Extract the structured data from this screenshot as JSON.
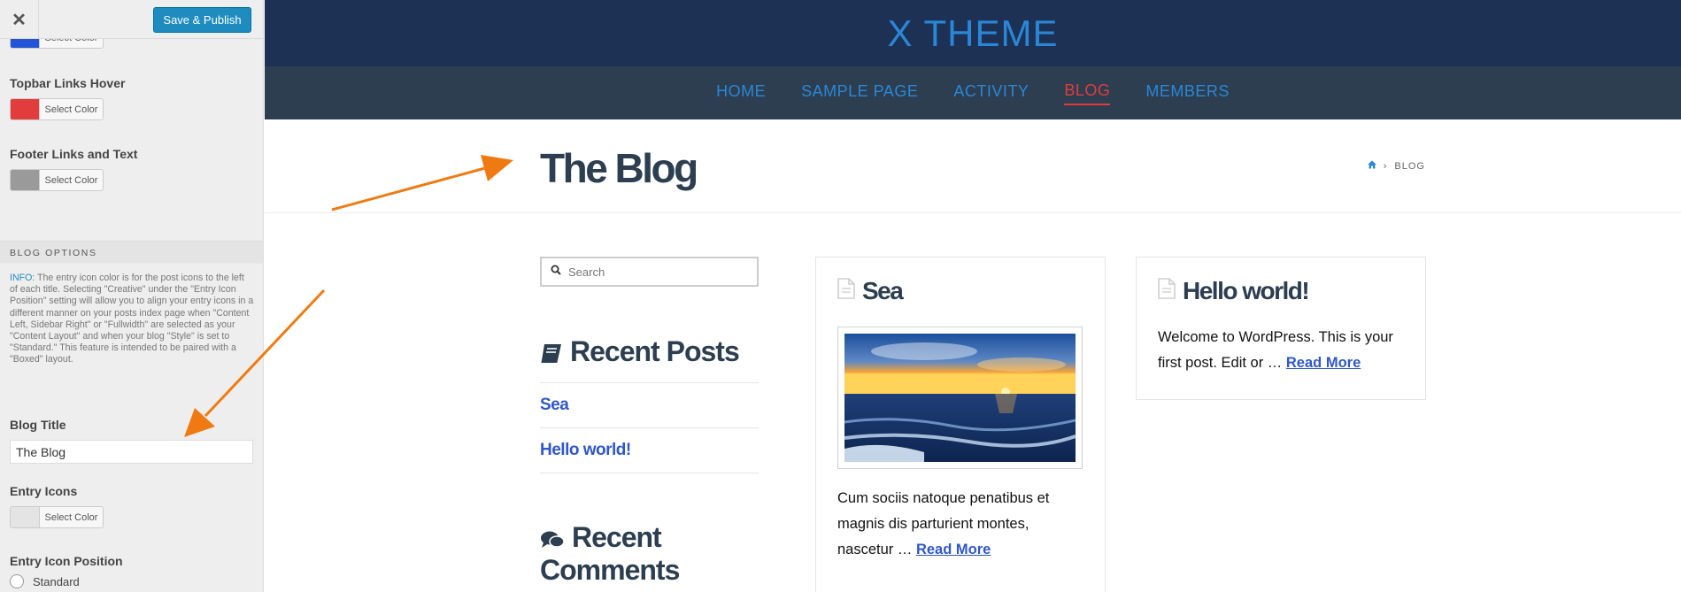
{
  "customizer": {
    "close_icon": "close-icon",
    "publish_label": "Save & Publish",
    "color_button_label": "Select Color",
    "topbar_links_hover": {
      "label": "Topbar Links Hover",
      "color": "#e23c3c"
    },
    "footer_links": {
      "label": "Footer Links and Text",
      "color": "#9a9a9a"
    },
    "partial_color": "#2354d8",
    "blog_options": {
      "heading": "BLOG OPTIONS",
      "info_label": "INFO:",
      "info_text": "The entry icon color is for the post icons to the left of each title. Selecting \"Creative\" under the \"Entry Icon Position\" setting will allow you to align your entry icons in a different manner on your posts index page when \"Content Left, Sidebar Right\" or \"Fullwidth\" are selected as your \"Content Layout\" and when your blog \"Style\" is set to \"Standard.\" This feature is intended to be paired with a \"Boxed\" layout.",
      "blog_title_label": "Blog Title",
      "blog_title_value": "The Blog",
      "entry_icons_label": "Entry Icons",
      "entry_icons_color": "#e4e4e4",
      "entry_icon_position_label": "Entry Icon Position",
      "radio_standard": "Standard"
    }
  },
  "site": {
    "logo": "X THEME",
    "nav": [
      "HOME",
      "SAMPLE PAGE",
      "ACTIVITY",
      "BLOG",
      "MEMBERS"
    ],
    "active_nav": "BLOG",
    "page_title": "The Blog",
    "breadcrumb_current": "BLOG",
    "breadcrumb_separator": "›",
    "search_placeholder": "Search",
    "recent_posts_title": "Recent Posts",
    "recent_posts": [
      "Sea",
      "Hello world!"
    ],
    "recent_comments_title": "Recent Comments",
    "posts": [
      {
        "title": "Sea",
        "excerpt": "Cum sociis natoque penatibus et magnis dis parturient montes, nascetur …",
        "read_more": "Read More"
      },
      {
        "title": "Hello world!",
        "excerpt": "Welcome to WordPress. This is your first post. Edit or …",
        "read_more": "Read More"
      }
    ]
  },
  "colors": {
    "masthead": "#1d3155",
    "navbar": "#2c3e50",
    "accent": "#2a87d7",
    "active_nav": "#e23c3c",
    "link": "#2f57c9",
    "annotation_arrow": "#f07a12"
  }
}
